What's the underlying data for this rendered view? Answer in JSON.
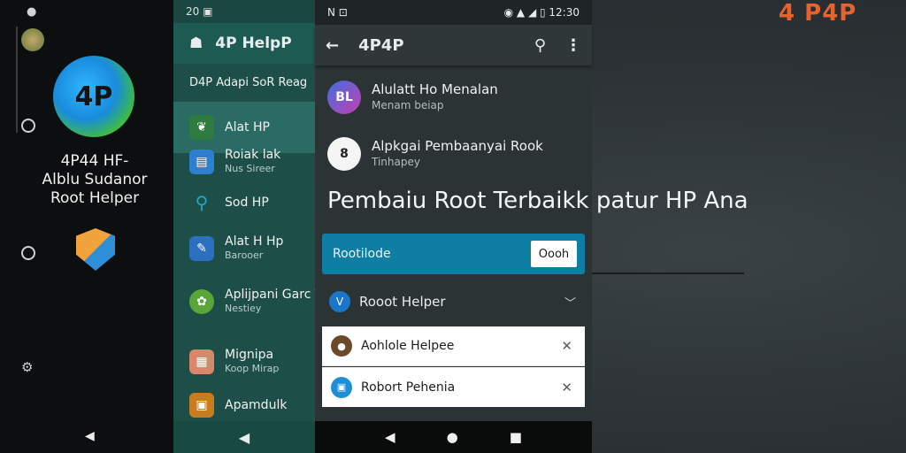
{
  "left": {
    "logo_text": "4P",
    "title_line1": "4P44 HF-",
    "title_line2": "Alblu Sudanor",
    "title_line3": "Root Helper",
    "back_glyph": "◀"
  },
  "drawer": {
    "status_time": "20",
    "app_title": "4P HelpP",
    "subtitle": "D4P Adapi SoR Reag",
    "items": [
      {
        "label": "Alat HP",
        "sub": "",
        "icon": "leaf-icon",
        "color": "#3a8b4a"
      },
      {
        "label": "Roiak lak",
        "sub": "Nus Sireer",
        "icon": "file-icon",
        "color": "#2f7fd0"
      },
      {
        "label": "Sod HP",
        "sub": "",
        "icon": "search-icon",
        "color": "#1ea7c9"
      },
      {
        "label": "Alat H Hp",
        "sub": "Barooer",
        "icon": "pen-icon",
        "color": "#2c6fbf"
      },
      {
        "label": "Aplijpani Garc Tenaiitama",
        "sub": "Nestiey",
        "icon": "gear-icon",
        "color": "#5aa63a"
      },
      {
        "label": "Mignipa",
        "sub": "Koop Mirap",
        "icon": "grid-icon",
        "color": "#d9866a"
      },
      {
        "label": "Apamdulk",
        "sub": "",
        "icon": "box-icon",
        "color": "#c97b22"
      }
    ],
    "back_glyph": "◀"
  },
  "panel": {
    "status_left": "N ⊡",
    "status_right": "◉ ▲ ◢ ▯ 12:30",
    "app_title": "4P4P",
    "rows": [
      {
        "title": "Alulatt Ho Menalan",
        "sub": "Menam beiap",
        "avatar": "BL",
        "color": "#7a3fcf"
      },
      {
        "title": "Alpkgai Pembaanyai Rook",
        "sub": "Tinhapey",
        "avatar": "8",
        "color": "#f5f5f5"
      }
    ],
    "headline": "Pembaiu Root Terbaikk patur HP Ana",
    "field_label": "Rootilode",
    "field_button": "Oooh",
    "expander_badge": "V",
    "expander_label": "Rooot Helper",
    "cards": [
      {
        "label": "Aohlole Helpee",
        "avatar_color": "#6b4a2a"
      },
      {
        "label": "Robort Pehenia",
        "avatar_color": "#1e8fd6"
      }
    ],
    "nav_back": "◀",
    "nav_home": "●",
    "nav_recent": "■"
  },
  "brand": "4 P4P",
  "left_nav_back": "◀"
}
